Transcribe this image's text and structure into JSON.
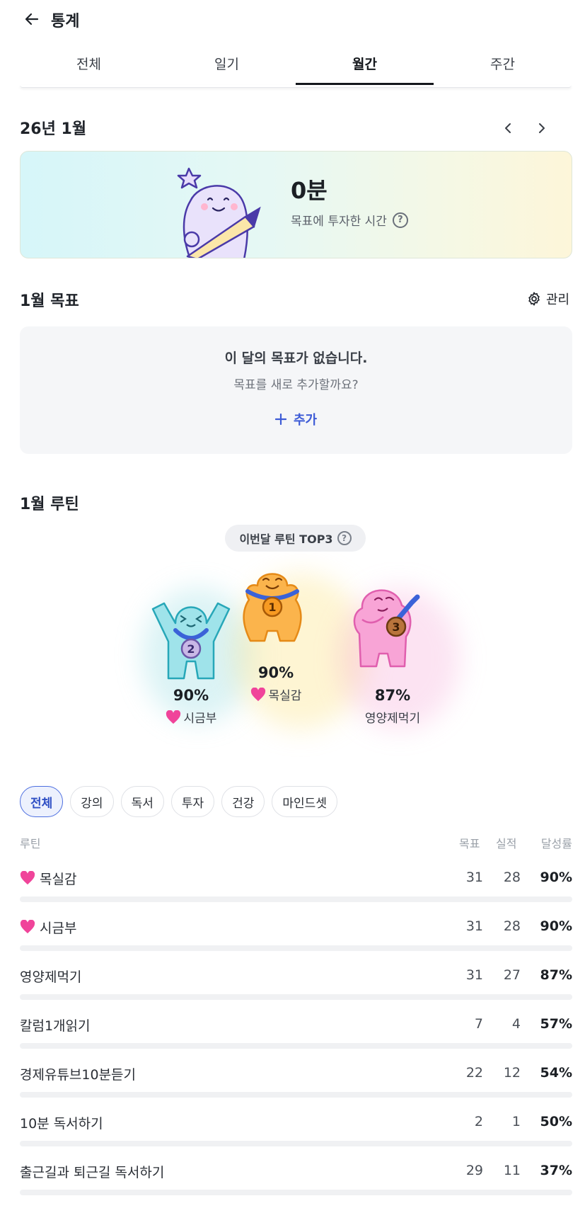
{
  "header": {
    "title": "통계",
    "back_icon": "arrow-left-icon"
  },
  "tabs": [
    {
      "label": "전체",
      "active": false
    },
    {
      "label": "일기",
      "active": false
    },
    {
      "label": "월간",
      "active": true
    },
    {
      "label": "주간",
      "active": false
    }
  ],
  "month": {
    "title": "26년 1월",
    "prev_icon": "chevron-left-icon",
    "next_icon": "chevron-right-icon"
  },
  "hero": {
    "value": "0분",
    "label": "목표에 투자한 시간",
    "help_icon": "question-circle-icon"
  },
  "goals": {
    "title": "1월 목표",
    "manage_label": "관리",
    "manage_icon": "gear-icon",
    "empty_title": "이 달의 목표가 없습니다.",
    "empty_sub": "목표를 새로 추가할까요?",
    "add_label": "추가"
  },
  "routine": {
    "title": "1월 루틴",
    "top3_label": "이번달 루틴 TOP3",
    "top3": [
      {
        "rank": "1",
        "pct": "90%",
        "name": "목실감",
        "heart": true,
        "color": "#f7a53b"
      },
      {
        "rank": "2",
        "pct": "90%",
        "name": "시금부",
        "heart": true,
        "color": "#7dd3dc"
      },
      {
        "rank": "3",
        "pct": "87%",
        "name": "영양제먹기",
        "heart": false,
        "color": "#f38bc8"
      }
    ]
  },
  "filters": [
    {
      "label": "전체",
      "active": true
    },
    {
      "label": "강의",
      "active": false
    },
    {
      "label": "독서",
      "active": false
    },
    {
      "label": "투자",
      "active": false
    },
    {
      "label": "건강",
      "active": false
    },
    {
      "label": "마인드셋",
      "active": false
    }
  ],
  "table": {
    "headers": {
      "routine": "루틴",
      "goal": "목표",
      "actual": "실적",
      "rate": "달성률"
    },
    "rows": [
      {
        "name": "목실감",
        "heart": true,
        "goal": "31",
        "actual": "28",
        "rate": "90%"
      },
      {
        "name": "시금부",
        "heart": true,
        "goal": "31",
        "actual": "28",
        "rate": "90%"
      },
      {
        "name": "영양제먹기",
        "heart": false,
        "goal": "31",
        "actual": "27",
        "rate": "87%"
      },
      {
        "name": "칼럼1개읽기",
        "heart": false,
        "goal": "7",
        "actual": "4",
        "rate": "57%"
      },
      {
        "name": "경제유튜브10분듣기",
        "heart": false,
        "goal": "22",
        "actual": "12",
        "rate": "54%"
      },
      {
        "name": "10분 독서하기",
        "heart": false,
        "goal": "2",
        "actual": "1",
        "rate": "50%"
      },
      {
        "name": "출근길과 퇴근길 독서하기",
        "heart": false,
        "goal": "29",
        "actual": "11",
        "rate": "37%"
      }
    ]
  },
  "colors": {
    "accent": "#3d5bd6",
    "heart": "#f0449a"
  }
}
